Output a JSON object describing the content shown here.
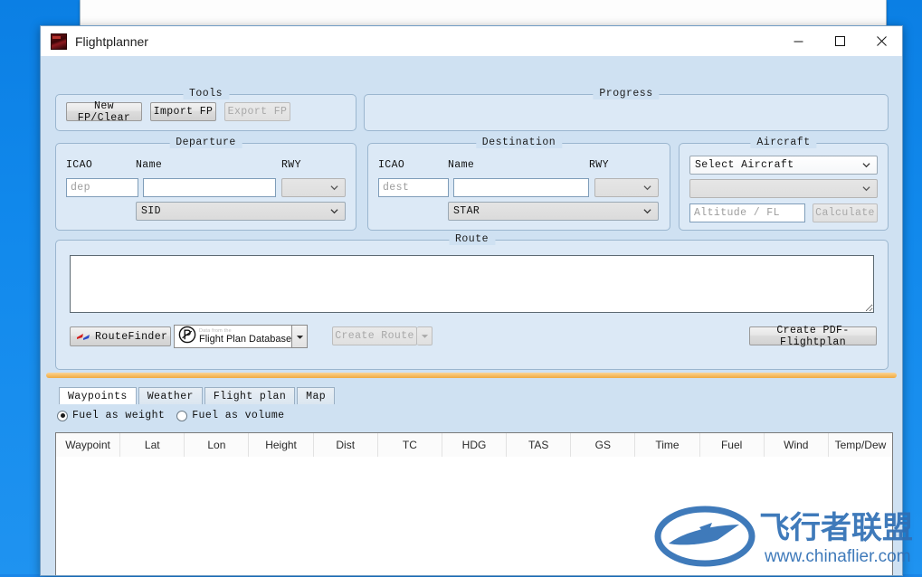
{
  "window": {
    "title": "Flightplanner",
    "app_icon": "app-icon",
    "minimize_label": "—",
    "maximize_label": "□",
    "close_label": "✕"
  },
  "tools": {
    "legend": "Tools",
    "buttons": [
      {
        "label": "New FP/Clear",
        "enabled": true
      },
      {
        "label": "Import FP",
        "enabled": true
      },
      {
        "label": "Export FP",
        "enabled": false
      }
    ]
  },
  "progress": {
    "legend": "Progress",
    "value": ""
  },
  "departure": {
    "legend": "Departure",
    "icao_label": "ICAO",
    "name_label": "Name",
    "rwy_label": "RWY",
    "icao_value": "",
    "icao_placeholder": "dep",
    "name_value": "",
    "name_placeholder": "",
    "rwy_value": "",
    "sid_value": "SID"
  },
  "destination": {
    "legend": "Destination",
    "icao_label": "ICAO",
    "name_label": "Name",
    "rwy_label": "RWY",
    "icao_value": "",
    "icao_placeholder": "dest",
    "name_value": "",
    "name_placeholder": "",
    "rwy_value": "",
    "star_value": "STAR"
  },
  "aircraft": {
    "legend": "Aircraft",
    "select_value": "Select Aircraft",
    "profile_value": "",
    "altitude_value": "",
    "altitude_placeholder": "Altitude / FL",
    "calculate_label": "Calculate"
  },
  "route": {
    "legend": "Route",
    "text_value": "",
    "routefinder_label": "RouteFinder",
    "fpdb_small_label": "Data from the",
    "fpdb_label": "Flight Plan Database",
    "create_route_label": "Create Route",
    "create_pdf_label": "Create PDF-Flightplan"
  },
  "tabs": [
    {
      "label": "Waypoints",
      "active": true
    },
    {
      "label": "Weather",
      "active": false
    },
    {
      "label": "Flight plan",
      "active": false
    },
    {
      "label": "Map",
      "active": false
    }
  ],
  "fuel_options": [
    {
      "label": "Fuel as weight",
      "checked": true
    },
    {
      "label": "Fuel as volume",
      "checked": false
    }
  ],
  "table": {
    "columns": [
      "Waypoint",
      "Lat",
      "Lon",
      "Height",
      "Dist",
      "TC",
      "HDG",
      "TAS",
      "GS",
      "Time",
      "Fuel",
      "Wind",
      "Temp/Dew"
    ],
    "rows": []
  },
  "watermark": {
    "brand_cn": "飞行者联盟",
    "url": "www.chinaflier.com",
    "color": "#2f6fb5"
  },
  "colors": {
    "window_bg": "#cfe1f2",
    "group_bg": "#dce9f6",
    "accent_splitter": "#f3b455",
    "desktop": "#1189ec"
  }
}
